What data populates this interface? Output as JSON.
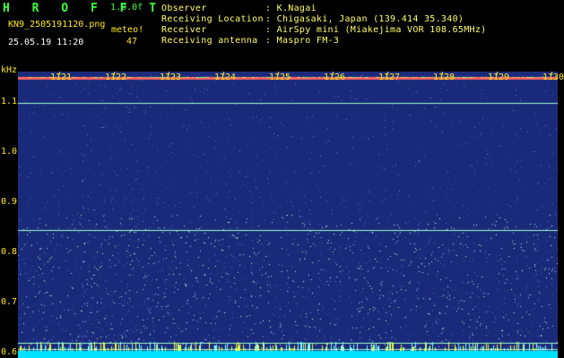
{
  "header": {
    "title": "H R O F F T",
    "version": "1.0.0f",
    "filename": "KN9_2505191120.png",
    "station": "meteo!",
    "timestamp": "25.05.19 11:20",
    "count": "47",
    "labels": [
      "Observer",
      "Receiving Location",
      "Receiver",
      "Receiving antenna"
    ],
    "values": [
      ": K.Nagai",
      ": Chigasaki, Japan (139.414 35.340)",
      ": AirSpy mini (Miakejima VOR 108.65MHz)",
      ": Maspro FM-3"
    ]
  },
  "chart_data": {
    "type": "heatmap",
    "ylabel": "kHz",
    "x_ticks": [
      "1121",
      "1122",
      "1123",
      "1124",
      "1125",
      "1126",
      "1127",
      "1128",
      "1129",
      "1130"
    ],
    "y_ticks": [
      "1.1",
      "1.0",
      "0.9",
      "0.8",
      "0.7",
      "0.6"
    ],
    "ylim": [
      0.59,
      1.16
    ],
    "horizontal_lines_khz": [
      1.148,
      1.098,
      0.845,
      0.62,
      0.607
    ],
    "colors": {
      "background": "#1a2a7a",
      "noise": "#3d5cd6",
      "carrier": "#a0ffcc",
      "top_band": "#ff6060",
      "baseline": "#00e0ff",
      "tick_text": "#ffe81a"
    }
  }
}
